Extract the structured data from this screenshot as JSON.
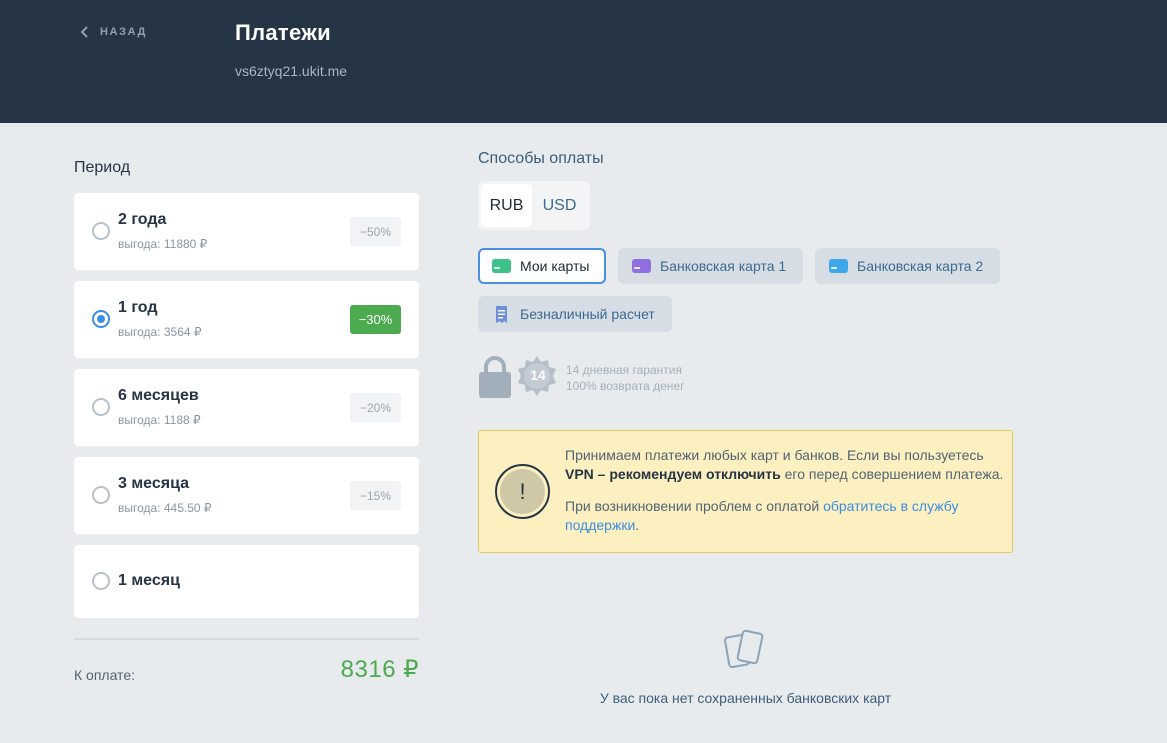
{
  "header": {
    "back_label": "НАЗАД",
    "title": "Платежи",
    "site": "vs6ztyq21.ukit.me"
  },
  "period": {
    "heading": "Период",
    "options": [
      {
        "name": "2 года",
        "saving": "выгода: 11880 ₽",
        "discount": "−50%",
        "selected": false
      },
      {
        "name": "1 год",
        "saving": "выгода: 3564 ₽",
        "discount": "−30%",
        "selected": true
      },
      {
        "name": "6 месяцев",
        "saving": "выгода: 1188 ₽",
        "discount": "−20%",
        "selected": false
      },
      {
        "name": "3 месяца",
        "saving": "выгода: 445.50 ₽",
        "discount": "−15%",
        "selected": false
      },
      {
        "name": "1 месяц",
        "selected": false
      }
    ],
    "total_label": "К оплате:",
    "total_value": "8316 ₽"
  },
  "methods": {
    "heading": "Способы оплаты",
    "currencies": [
      "RUB",
      "USD"
    ],
    "selected_currency": "RUB",
    "chips": [
      {
        "label": "Мои карты",
        "icon": "card-green-icon",
        "color": "#3fc18a",
        "selected": true
      },
      {
        "label": "Банковская карта 1",
        "icon": "card-purple-icon",
        "color": "#8f6fe0",
        "selected": false
      },
      {
        "label": "Банковская карта 2",
        "icon": "card-blue-icon",
        "color": "#3fa6ea",
        "selected": false
      },
      {
        "label": "Безналичный расчет",
        "icon": "invoice-icon",
        "color": "#6c8fd6",
        "selected": false
      }
    ],
    "guarantee_days": "14",
    "guarantee_line1": "14 дневная гарантия",
    "guarantee_line2": "100% возврата денег"
  },
  "notice": {
    "p1_start": "Принимаем платежи любых карт и банков. Если вы пользуетесь ",
    "p1_bold": "VPN – рекомендуем отключить",
    "p1_end": " его перед совершением платежа.",
    "p2_start": "При возникновении проблем с оплатой ",
    "p2_link": "обратитесь в службу поддержки",
    "p2_end": "."
  },
  "empty_state": {
    "text": "У вас пока нет сохраненных банковских карт"
  },
  "colors": {
    "header_bg": "#253545",
    "accent": "#3a8de4",
    "success": "#4caa4f",
    "notice_bg": "#fcf0c0"
  }
}
